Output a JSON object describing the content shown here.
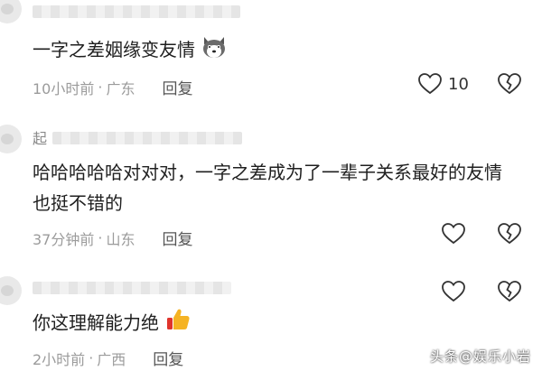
{
  "comments": [
    {
      "name": "",
      "text": "一字之差姻缘变友情",
      "emoji": "husky-emoji",
      "time": "10小时前",
      "location": "广东",
      "reply_label": "回复",
      "like_count": "10"
    },
    {
      "name": "起",
      "text": "哈哈哈哈哈对对对，一字之差成为了一辈子关系最好的友情也挺不错的",
      "time": "37分钟前",
      "location": "山东",
      "reply_label": "回复",
      "like_count": ""
    },
    {
      "name": "",
      "text": "你这理解能力绝",
      "emoji": "thumbs-up-emoji",
      "time": "2小时前",
      "location": "广西",
      "reply_label": "回复",
      "like_count": ""
    }
  ],
  "meta_separator": "·",
  "watermark": "头条@娱乐小岩"
}
